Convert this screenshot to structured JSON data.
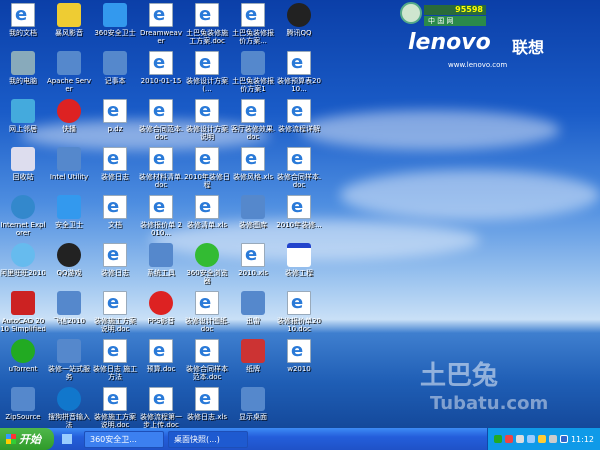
{
  "desktop": {
    "icons": [
      {
        "label": "我的文档",
        "icon": "ie-doc"
      },
      {
        "label": "暴风影音",
        "icon": "media-player"
      },
      {
        "label": "360安全卫士",
        "icon": "shield"
      },
      {
        "label": "Dreamweaver",
        "icon": "ie-doc"
      },
      {
        "label": "土巴兔装修施工方案.doc",
        "icon": "ie-doc"
      },
      {
        "label": "土巴兔装修报价方案...",
        "icon": "ie-doc"
      },
      {
        "label": "腾讯QQ",
        "icon": "qq"
      },
      {
        "label": "我的电脑",
        "icon": "my-computer"
      },
      {
        "label": "Apache Server",
        "icon": "app"
      },
      {
        "label": "记事本",
        "icon": "app"
      },
      {
        "label": "2010-01-15",
        "icon": "ie-doc"
      },
      {
        "label": "装修设计方案(...",
        "icon": "ie-doc"
      },
      {
        "label": "土巴兔装修报价方案1",
        "icon": "app"
      },
      {
        "label": "装修预算表2010...",
        "icon": "ie-doc"
      },
      {
        "label": "网上邻居",
        "icon": "network"
      },
      {
        "label": "快播",
        "icon": "player"
      },
      {
        "label": "p.dz",
        "icon": "ie-doc"
      },
      {
        "label": "装修合同范本.doc",
        "icon": "ie-doc"
      },
      {
        "label": "装修设计方案说明",
        "icon": "ie-doc"
      },
      {
        "label": "客厅装修效果.doc",
        "icon": "ie-doc"
      },
      {
        "label": "装修流程详解",
        "icon": "ie-doc"
      },
      {
        "label": "回收站",
        "icon": "recycle-bin"
      },
      {
        "label": "Intel Utility",
        "icon": "app"
      },
      {
        "label": "装修日志",
        "icon": "ie-doc"
      },
      {
        "label": "装修材料清单.doc",
        "icon": "ie-doc"
      },
      {
        "label": "2010年装修日程",
        "icon": "ie-doc"
      },
      {
        "label": "装修风格.xls",
        "icon": "ie-doc"
      },
      {
        "label": "装修合同样本.doc",
        "icon": "ie-doc"
      },
      {
        "label": "Internet Explorer",
        "icon": "ie"
      },
      {
        "label": "安全卫士",
        "icon": "shield"
      },
      {
        "label": "文档",
        "icon": "ie-doc"
      },
      {
        "label": "装修报价单 2010...",
        "icon": "ie-doc"
      },
      {
        "label": "装修清单.xls",
        "icon": "ie-doc"
      },
      {
        "label": "装修图库",
        "icon": "app"
      },
      {
        "label": "2010年装修...",
        "icon": "ie-doc"
      },
      {
        "label": "阿里旺旺2010",
        "icon": "chat"
      },
      {
        "label": "QQ游戏",
        "icon": "qq"
      },
      {
        "label": "装修日志",
        "icon": "ie-doc"
      },
      {
        "label": "系统工具",
        "icon": "app"
      },
      {
        "label": "360安全浏览器",
        "icon": "browser"
      },
      {
        "label": "2010.xls",
        "icon": "ie-doc"
      },
      {
        "label": "装修工程",
        "icon": "window"
      },
      {
        "label": "AutoCAD 2010 Simplified",
        "icon": "autocad"
      },
      {
        "label": "飞信2010",
        "icon": "app"
      },
      {
        "label": "装修施工方案说明.doc",
        "icon": "ie-doc"
      },
      {
        "label": "PPS影音",
        "icon": "player"
      },
      {
        "label": "装修设计图纸.doc",
        "icon": "ie-doc"
      },
      {
        "label": "迅雷",
        "icon": "app"
      },
      {
        "label": "装修报价单2010.doc",
        "icon": "ie-doc"
      },
      {
        "label": "uTorrent",
        "icon": "torrent"
      },
      {
        "label": "装修一站式服务",
        "icon": "app"
      },
      {
        "label": "装修日志 施工方法",
        "icon": "ie-doc"
      },
      {
        "label": "预算.doc",
        "icon": "ie-doc"
      },
      {
        "label": "装修合同样本 范本.doc",
        "icon": "ie-doc"
      },
      {
        "label": "纸牌",
        "icon": "cards"
      },
      {
        "label": "w2010",
        "icon": "ie-doc"
      },
      {
        "label": "ZipSource",
        "icon": "app"
      },
      {
        "label": "搜狗拼音输入法",
        "icon": "sogou"
      },
      {
        "label": "装修施工方案说明.doc",
        "icon": "ie-doc"
      },
      {
        "label": "装修流程第一步上传.doc",
        "icon": "ie-doc"
      },
      {
        "label": "装修日志.xls",
        "icon": "ie-doc"
      },
      {
        "label": "显示桌面",
        "icon": "app"
      }
    ]
  },
  "branding": {
    "hotline": "95598",
    "hotline_sub": "中 国 网",
    "logo": "lenovo",
    "logo_cn": "联想",
    "url": "www.lenovo.com"
  },
  "watermark": {
    "cn": "土巴兔",
    "en": "Tubatu.com"
  },
  "taskbar": {
    "start": "开始",
    "tasks": [
      "360安全卫...",
      "桌面快照(...)"
    ],
    "clock": "11:12"
  }
}
